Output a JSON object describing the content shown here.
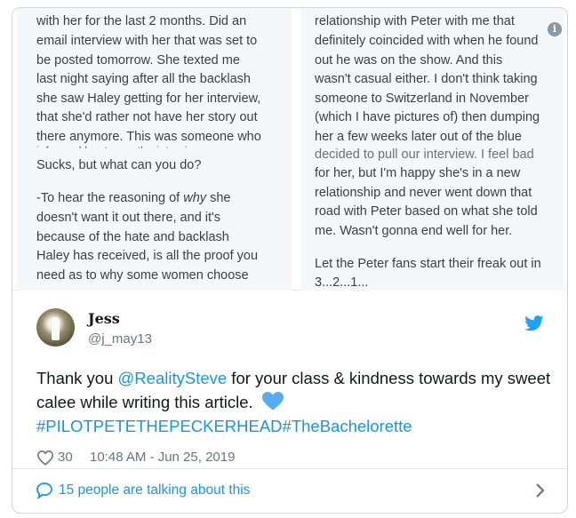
{
  "media": {
    "left_lines": [
      "with her for the last 2 months. Did an",
      "email interview with her that was set to",
      "be posted tomorrow. She texted me",
      "last night saying after all the backlash",
      "she saw Haley getting for her interview,",
      "that she'd rather not have her story out",
      "there anymore. This was someone who",
      "Sucks, but what can you do?",
      "-To hear the reasoning of why she",
      "doesn't want it out there, and it's",
      "because of the hate and backlash",
      "Haley has received, is all the proof you",
      "need as to why some women choose"
    ],
    "left_overlap": "informed her to run the interview.",
    "right_lines": [
      "relationship with Peter with me that",
      "definitely coincided with when he found",
      "out he was on the show. And this",
      "wasn't casual either. I don't think taking",
      "someone to Switzerland in November",
      "(which I have pictures of) then dumping",
      "her a few weeks later out of the blue",
      "decided to pull our interview. I feel bad",
      "for her, but I'm happy she's in a new",
      "relationship and never went down that",
      "road with Peter based on what she told",
      "me. Wasn't gonna end well for her.",
      "Let the Peter fans start their freak out in",
      "3...2...1..."
    ],
    "info_icon": "info-icon"
  },
  "tweet": {
    "author_name": "Jess",
    "author_handle": "@j_may13",
    "text_before": "Thank you ",
    "mention": "@RealitySteve",
    "text_after": " for your class & kindness towards my sweet calee while writing this article. ",
    "hashtags": "#PILOTPETETHEPECKERHEAD#TheBachelorette",
    "likes": "30",
    "timestamp": "10:48 AM - Jun 25, 2019"
  },
  "footer": {
    "talking": "15 people are talking about this"
  },
  "colors": {
    "link": "#1b95e0",
    "muted": "#657786",
    "border": "#ccd6dd",
    "panel_bg": "#f5f8fa"
  }
}
